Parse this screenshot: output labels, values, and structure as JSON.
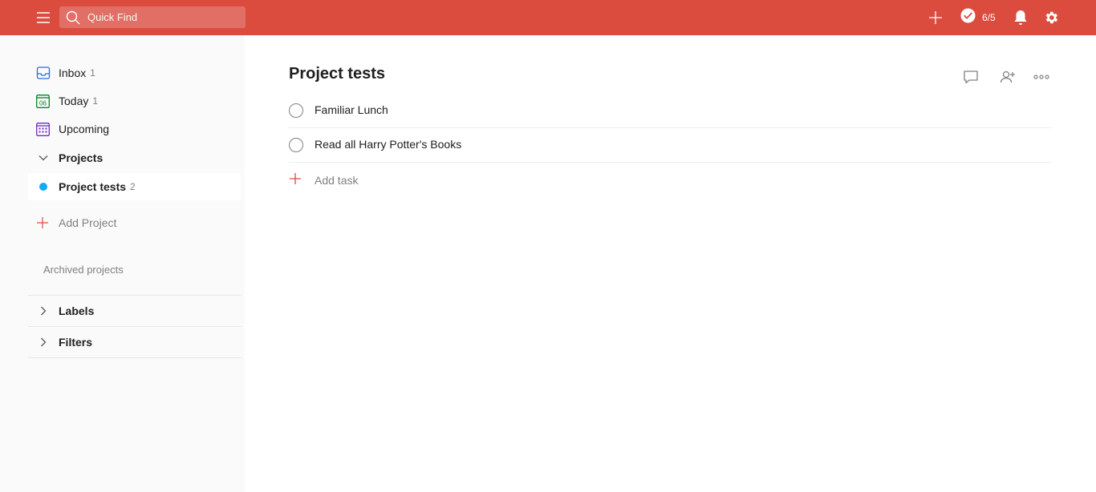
{
  "topbar": {
    "search_placeholder": "Quick Find",
    "karma_label": "6/5",
    "brand_color": "#db4c3f",
    "icons": [
      "menu-icon",
      "search-icon",
      "plus-icon",
      "check-circle-icon",
      "bell-icon",
      "gear-icon"
    ]
  },
  "sidebar": {
    "items": [
      {
        "label": "Inbox",
        "count": "1",
        "icon": "inbox-icon"
      },
      {
        "label": "Today",
        "count": "1",
        "icon": "calendar-today-icon",
        "icon_text": "06"
      },
      {
        "label": "Upcoming",
        "count": "",
        "icon": "calendar-upcoming-icon"
      }
    ],
    "projects_header": "Projects",
    "projects": [
      {
        "label": "Project tests",
        "count": "2",
        "color": "#14aaf5"
      }
    ],
    "add_project_label": "Add Project",
    "archived_label": "Archived projects",
    "labels_header": "Labels",
    "filters_header": "Filters"
  },
  "main": {
    "title": "Project tests",
    "tasks": [
      {
        "text": "Familiar Lunch"
      },
      {
        "text": "Read all Harry Potter's Books"
      }
    ],
    "add_task_label": "Add task"
  }
}
